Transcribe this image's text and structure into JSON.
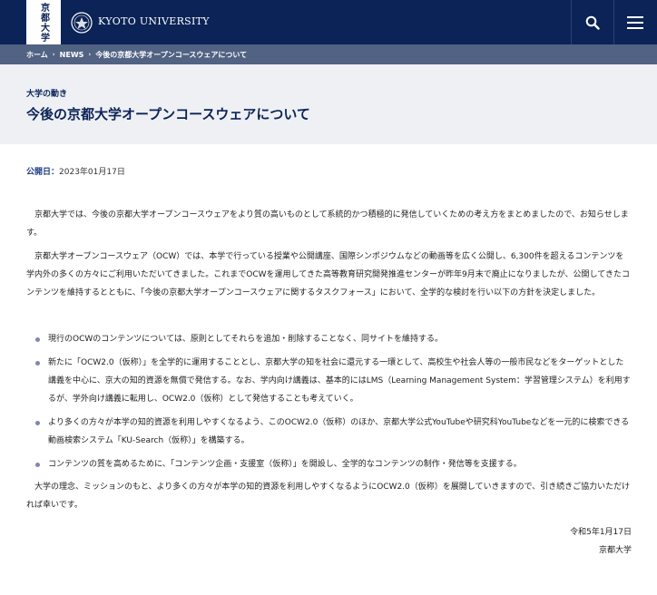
{
  "header": {
    "logo_vertical": "京都大学",
    "university_name": "KYOTO UNIVERSITY",
    "search_icon": "search-icon",
    "menu_icon": "hamburger-menu-icon",
    "colors": {
      "navy": "#0b2356",
      "breadcrumb_bg": "#516283",
      "title_band_bg": "#eef0f4",
      "bullet": "#7d86b4"
    }
  },
  "breadcrumb": {
    "items": [
      "ホーム",
      "NEWS",
      "今後の京都大学オープンコースウェアについて"
    ],
    "separator": "›"
  },
  "page": {
    "category": "大学の動き",
    "title": "今後の京都大学オープンコースウェアについて",
    "published_label": "公開日：",
    "published_date": "2023年01月17日"
  },
  "body": {
    "paragraph1": "京都大学では、今後の京都大学オープンコースウェアをより質の高いものとして系統的かつ積極的に発信していくための考え方をまとめましたので、お知らせします。",
    "paragraph2": "京都大学オープンコースウェア（OCW）では、本学で行っている授業や公開講座、国際シンポジウムなどの動画等を広く公開し、6,300件を超えるコンテンツを学内外の多くの方々にご利用いただいてきました。これまでOCWを運用してきた高等教育研究開発推進センターが昨年9月末で廃止になりましたが、公開してきたコンテンツを維持するとともに、「今後の京都大学オープンコースウェアに関するタスクフォース」において、全学的な検討を行い以下の方針を決定しました。",
    "bullets": [
      "現行のOCWのコンテンツについては、原則としてそれらを追加・削除することなく、同サイトを維持する。",
      "新たに「OCW2.0（仮称）」を全学的に運用することとし、京都大学の知を社会に還元する一環として、高校生や社会人等の一般市民などをターゲットとした講義を中心に、京大の知的資源を無償で発信する。なお、学内向け講義は、基本的にはLMS（Learning Management System：学習管理システム）を利用するが、学外向け講義に転用し、OCW2.0（仮称）として発信することも考えていく。",
      "より多くの方々が本学の知的資源を利用しやすくなるよう、このOCW2.0（仮称）のほか、京都大学公式YouTubeや研究科YouTubeなどを一元的に検索できる動画検索システム「KU-Search（仮称）」を構築する。",
      "コンテンツの質を高めるために、「コンテンツ企画・支援室（仮称）」を開設し、全学的なコンテンツの制作・発信等を支援する。"
    ],
    "paragraph3": "大学の理念、ミッションのもと、より多くの方々が本学の知的資源を利用しやすくなるようにOCW2.0（仮称）を展開していきますので、引き続きご協力いただければ幸いです。",
    "sign_date": "令和5年1月17日",
    "sign_name": "京都大学"
  }
}
